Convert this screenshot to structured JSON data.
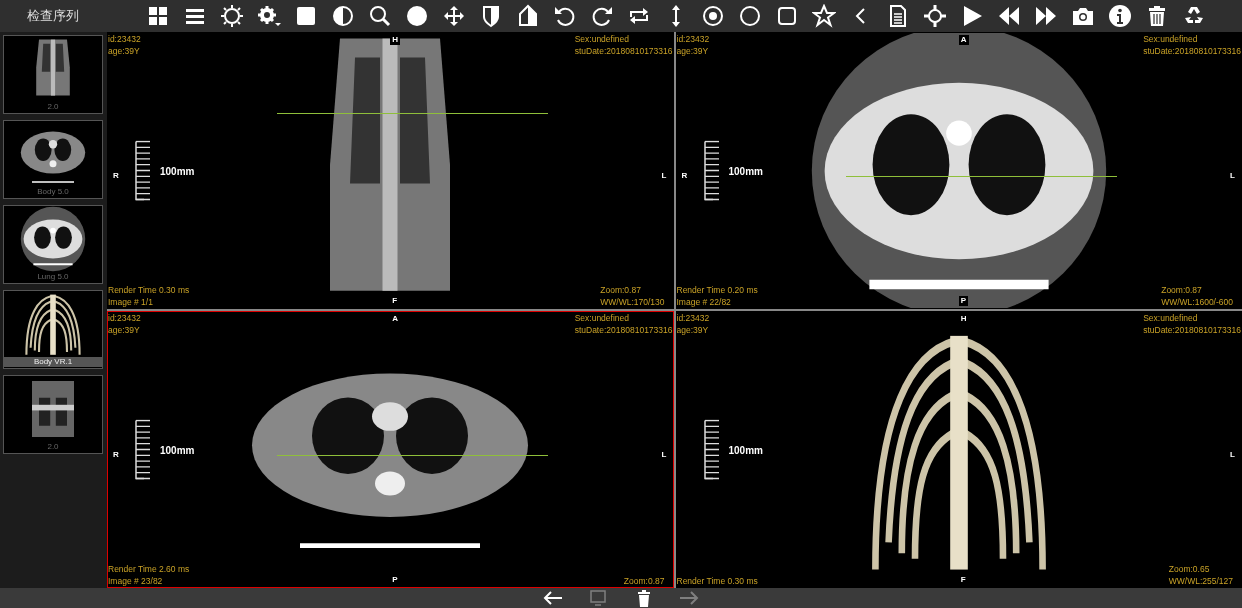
{
  "toolbar": {
    "title": "检查序列",
    "tools": [
      {
        "kind": "layout"
      },
      {
        "kind": "menu"
      },
      {
        "kind": "sun"
      },
      {
        "kind": "gear"
      },
      {
        "kind": "square"
      },
      {
        "kind": "contrast"
      },
      {
        "kind": "search"
      },
      {
        "kind": "dot"
      },
      {
        "kind": "move"
      },
      {
        "kind": "shield"
      },
      {
        "kind": "house"
      },
      {
        "kind": "rotl"
      },
      {
        "kind": "rotr"
      },
      {
        "kind": "repeat"
      },
      {
        "kind": "vert"
      },
      {
        "kind": "target"
      },
      {
        "kind": "ring"
      },
      {
        "kind": "rsquare"
      },
      {
        "kind": "star"
      },
      {
        "kind": "chevron"
      },
      {
        "kind": "doc"
      },
      {
        "kind": "cross"
      },
      {
        "kind": "play"
      },
      {
        "kind": "rew"
      },
      {
        "kind": "ff"
      },
      {
        "kind": "camera"
      },
      {
        "kind": "info"
      },
      {
        "kind": "trash"
      },
      {
        "kind": "recycle"
      }
    ]
  },
  "sidebar": {
    "items": [
      {
        "label": "2.0",
        "kind": "xray",
        "selected": false
      },
      {
        "label": "Body 5.0",
        "kind": "body",
        "selected": false
      },
      {
        "label": "Lung 5.0",
        "kind": "lung",
        "selected": false
      },
      {
        "label": "Body VR.1",
        "kind": "ribs",
        "selected": true
      },
      {
        "label": "2.0",
        "kind": "coronal",
        "selected": false
      }
    ]
  },
  "viewports": [
    {
      "kind": "xray",
      "active": false,
      "reference_line": true,
      "top_left": [
        "id:23432",
        "age:39Y"
      ],
      "top_right": [
        "Sex:undefined",
        "stuDate:20180810173316"
      ],
      "bottom_left": [
        "Render Time 0.30 ms",
        "Image # 1/1"
      ],
      "bottom_right": [
        "Zoom:0.87",
        "WW/WL:170/130"
      ],
      "orient": {
        "top": "H",
        "bottom": "F",
        "left": "R",
        "right": "L"
      },
      "scale": "100mm"
    },
    {
      "kind": "lung",
      "active": false,
      "reference_line": true,
      "top_left": [
        "id:23432",
        "age:39Y"
      ],
      "top_right": [
        "Sex:undefined",
        "stuDate:20180810173316"
      ],
      "bottom_left": [
        "Render Time 0.20 ms",
        "Image # 22/82"
      ],
      "bottom_right": [
        "Zoom:0.87",
        "WW/WL:1600/-600"
      ],
      "orient": {
        "top": "A",
        "bottom": "P",
        "left": "R",
        "right": "L"
      },
      "scale": "100mm"
    },
    {
      "kind": "body",
      "active": true,
      "reference_line": true,
      "top_left": [
        "id:23432",
        "age:39Y"
      ],
      "top_right": [
        "Sex:undefined",
        "stuDate:20180810173316"
      ],
      "bottom_left": [
        "Render Time 2.60 ms",
        "Image # 23/82"
      ],
      "bottom_right": [
        "Zoom:0.87"
      ],
      "orient": {
        "top": "A",
        "bottom": "P",
        "left": "R",
        "right": "L"
      },
      "scale": "100mm"
    },
    {
      "kind": "ribs",
      "active": false,
      "reference_line": false,
      "top_left": [
        "id:23432",
        "age:39Y"
      ],
      "top_right": [
        "Sex:undefined",
        "stuDate:20180810173316"
      ],
      "bottom_left": [
        "Render Time 0.30 ms"
      ],
      "bottom_right": [
        "Zoom:0.65",
        "WW/WL:255/127"
      ],
      "orient": {
        "top": "H",
        "bottom": "F",
        "right": "L"
      },
      "scale": "100mm"
    }
  ],
  "bottom_bar": [
    {
      "kind": "back",
      "disabled": false
    },
    {
      "kind": "monitor",
      "disabled": true
    },
    {
      "kind": "trash",
      "disabled": false
    },
    {
      "kind": "forward",
      "disabled": true
    }
  ]
}
